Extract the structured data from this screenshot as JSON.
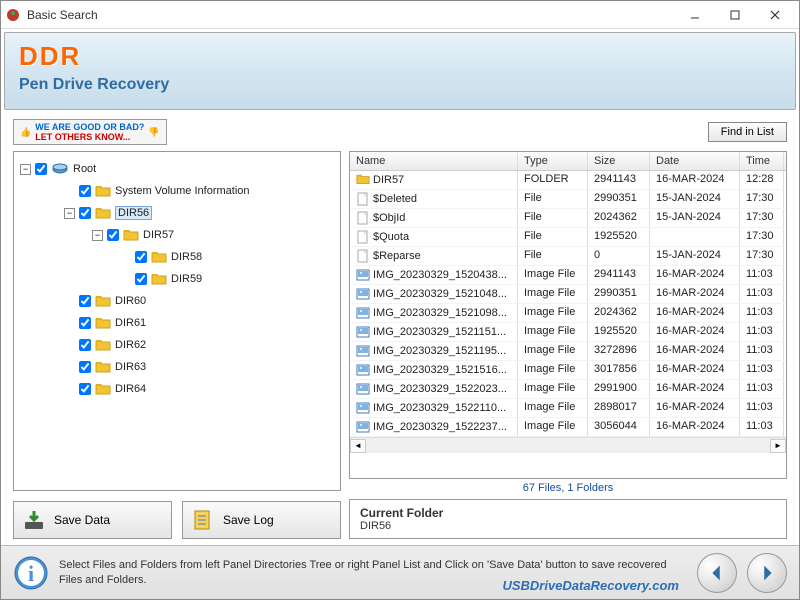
{
  "titlebar": {
    "title": "Basic Search"
  },
  "header": {
    "brand": "DDR",
    "subtitle": "Pen Drive Recovery"
  },
  "promo": {
    "line1": "WE ARE GOOD OR BAD?",
    "line2": "LET OTHERS KNOW..."
  },
  "buttons": {
    "find_in_list": "Find in List",
    "save_data": "Save Data",
    "save_log": "Save Log"
  },
  "tree": {
    "root_label": "Root",
    "items": [
      {
        "label": "System Volume Information",
        "indent": 1,
        "toggle": ""
      },
      {
        "label": "DIR56",
        "indent": 1,
        "toggle": "−",
        "selected": true
      },
      {
        "label": "DIR57",
        "indent": 2,
        "toggle": "−"
      },
      {
        "label": "DIR58",
        "indent": 3,
        "toggle": ""
      },
      {
        "label": "DIR59",
        "indent": 3,
        "toggle": ""
      },
      {
        "label": "DIR60",
        "indent": 1,
        "toggle": ""
      },
      {
        "label": "DIR61",
        "indent": 1,
        "toggle": ""
      },
      {
        "label": "DIR62",
        "indent": 1,
        "toggle": ""
      },
      {
        "label": "DIR63",
        "indent": 1,
        "toggle": ""
      },
      {
        "label": "DIR64",
        "indent": 1,
        "toggle": ""
      }
    ]
  },
  "list": {
    "headers": {
      "name": "Name",
      "type": "Type",
      "size": "Size",
      "date": "Date",
      "time": "Time"
    },
    "rows": [
      {
        "icon": "folder",
        "name": "DIR57",
        "type": "FOLDER",
        "size": "2941143",
        "date": "16-MAR-2024",
        "time": "12:28"
      },
      {
        "icon": "file",
        "name": "$Deleted",
        "type": "File",
        "size": "2990351",
        "date": "15-JAN-2024",
        "time": "17:30"
      },
      {
        "icon": "file",
        "name": "$ObjId",
        "type": "File",
        "size": "2024362",
        "date": "15-JAN-2024",
        "time": "17:30"
      },
      {
        "icon": "file",
        "name": "$Quota",
        "type": "File",
        "size": "1925520",
        "date": "",
        "time": "17:30"
      },
      {
        "icon": "file",
        "name": "$Reparse",
        "type": "File",
        "size": "0",
        "date": "15-JAN-2024",
        "time": "17:30"
      },
      {
        "icon": "image",
        "name": "IMG_20230329_1520438...",
        "type": "Image File",
        "size": "2941143",
        "date": "16-MAR-2024",
        "time": "11:03"
      },
      {
        "icon": "image",
        "name": "IMG_20230329_1521048...",
        "type": "Image File",
        "size": "2990351",
        "date": "16-MAR-2024",
        "time": "11:03"
      },
      {
        "icon": "image",
        "name": "IMG_20230329_1521098...",
        "type": "Image File",
        "size": "2024362",
        "date": "16-MAR-2024",
        "time": "11:03"
      },
      {
        "icon": "image",
        "name": "IMG_20230329_1521151...",
        "type": "Image File",
        "size": "1925520",
        "date": "16-MAR-2024",
        "time": "11:03"
      },
      {
        "icon": "image",
        "name": "IMG_20230329_1521195...",
        "type": "Image File",
        "size": "3272896",
        "date": "16-MAR-2024",
        "time": "11:03"
      },
      {
        "icon": "image",
        "name": "IMG_20230329_1521516...",
        "type": "Image File",
        "size": "3017856",
        "date": "16-MAR-2024",
        "time": "11:03"
      },
      {
        "icon": "image",
        "name": "IMG_20230329_1522023...",
        "type": "Image File",
        "size": "2991900",
        "date": "16-MAR-2024",
        "time": "11:03"
      },
      {
        "icon": "image",
        "name": "IMG_20230329_1522110...",
        "type": "Image File",
        "size": "2898017",
        "date": "16-MAR-2024",
        "time": "11:03"
      },
      {
        "icon": "image",
        "name": "IMG_20230329_1522237...",
        "type": "Image File",
        "size": "3056044",
        "date": "16-MAR-2024",
        "time": "11:03"
      }
    ]
  },
  "status": {
    "summary": "67 Files, 1 Folders"
  },
  "current_folder": {
    "title": "Current Folder",
    "value": "DIR56"
  },
  "footer": {
    "help": "Select Files and Folders from left Panel Directories Tree or right Panel List and Click on 'Save Data' button to save recovered Files and Folders.",
    "url": "USBDriveDataRecovery.com"
  }
}
